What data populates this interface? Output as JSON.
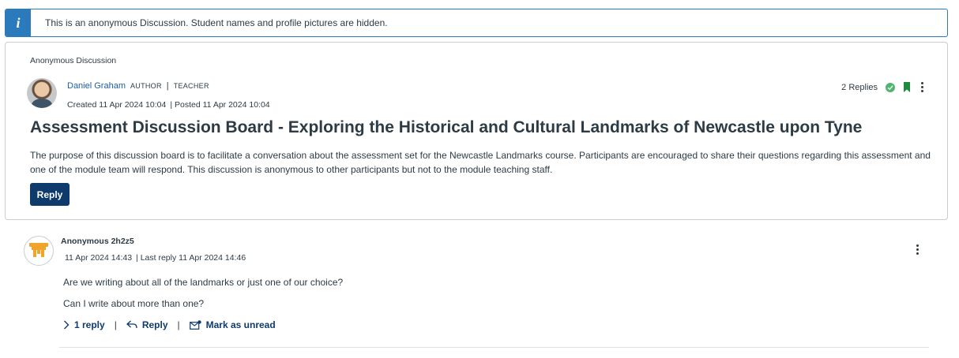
{
  "banner": {
    "icon": "info-icon",
    "text": "This is an anonymous Discussion. Student names and profile pictures are hidden."
  },
  "topic": {
    "anonymous_label": "Anonymous Discussion",
    "author_name": "Daniel Graham",
    "roles": [
      "AUTHOR",
      "TEACHER"
    ],
    "role_separator": "|",
    "created": "Created 11 Apr 2024 10:04",
    "posted": "| Posted 11 Apr 2024 10:04",
    "replies_count": "2 Replies",
    "title": "Assessment Discussion Board - Exploring the Historical and Cultural Landmarks of Newcastle upon Tyne",
    "body": "The purpose of this discussion board is to facilitate a conversation about the assessment set for the Newcastle Landmarks course. Participants are encouraged to share their questions regarding this assessment and one of the module team will respond. This discussion is anonymous to other participants but not to the module teaching staff.",
    "reply_label": "Reply",
    "colors": {
      "accent": "#0e3a6c",
      "bookmark": "#1e8a3e",
      "check": "#4fb66d",
      "info": "#2b7abc"
    }
  },
  "entry": {
    "author_name": "Anonymous 2h2z5",
    "date": "11 Apr 2024 14:43",
    "last_reply": "| Last reply 11 Apr 2024 14:46",
    "paragraphs": [
      "Are we writing about all of the landmarks or just one of our choice?",
      "Can I write about more than one?"
    ],
    "actions": {
      "expand_label": "1 reply",
      "reply_label": "Reply",
      "mark_unread_label": "Mark as unread",
      "separator": "|"
    },
    "avatar_color": "#f0a42a"
  }
}
